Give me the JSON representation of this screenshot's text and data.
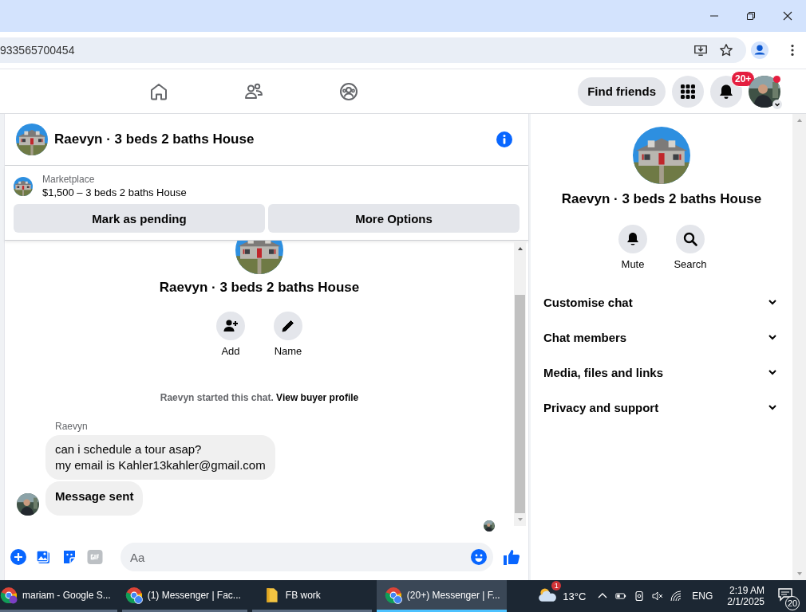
{
  "browser": {
    "url": "933565700454"
  },
  "nav": {
    "find_friends": "Find friends",
    "notification_badge": "20+"
  },
  "chat": {
    "title": "Raevyn · 3 beds 2 baths House",
    "listing": {
      "source": "Marketplace",
      "summary": "$1,500 – 3 beds 2 baths House"
    },
    "actions": [
      "Mark as pending",
      "More Options"
    ],
    "intro": {
      "title": "Raevyn · 3 beds 2 baths House",
      "actions": [
        {
          "label": "Add",
          "kind": "add"
        },
        {
          "label": "Name",
          "kind": "name"
        }
      ],
      "started_text": "Raevyn started this chat.",
      "link": "View buyer profile"
    },
    "sender": "Raevyn",
    "messages": [
      {
        "kind": "text",
        "text": "can i schedule a tour asap?\nmy email is Kahler13kahler@gmail.com"
      },
      {
        "kind": "status",
        "text": "Message sent"
      }
    ],
    "composer": {
      "placeholder": "Aa"
    }
  },
  "details": {
    "title": "Raevyn · 3 beds 2 baths House",
    "actions": [
      {
        "label": "Mute",
        "kind": "mute"
      },
      {
        "label": "Search",
        "kind": "search"
      }
    ],
    "sections": [
      {
        "label": "Customise chat",
        "expanded": false
      },
      {
        "label": "Chat members",
        "expanded": false
      },
      {
        "label": "Media, files and links",
        "expanded": false
      },
      {
        "label": "Privacy and support",
        "expanded": false
      }
    ]
  },
  "taskbar": {
    "apps": [
      {
        "label": "mariam - Google S...",
        "kind": "chrome-profile",
        "selected": false
      },
      {
        "label": "(1) Messenger | Fac...",
        "kind": "chrome",
        "selected": false
      },
      {
        "label": "FB work",
        "kind": "folder",
        "selected": false
      },
      {
        "label": "(20+) Messenger | F...",
        "kind": "chrome",
        "selected": true
      }
    ],
    "weather_badge": "1",
    "temperature": "13°C",
    "language": "ENG",
    "time": "2:19 AM",
    "date": "2/1/2025",
    "notification_count": "20"
  }
}
